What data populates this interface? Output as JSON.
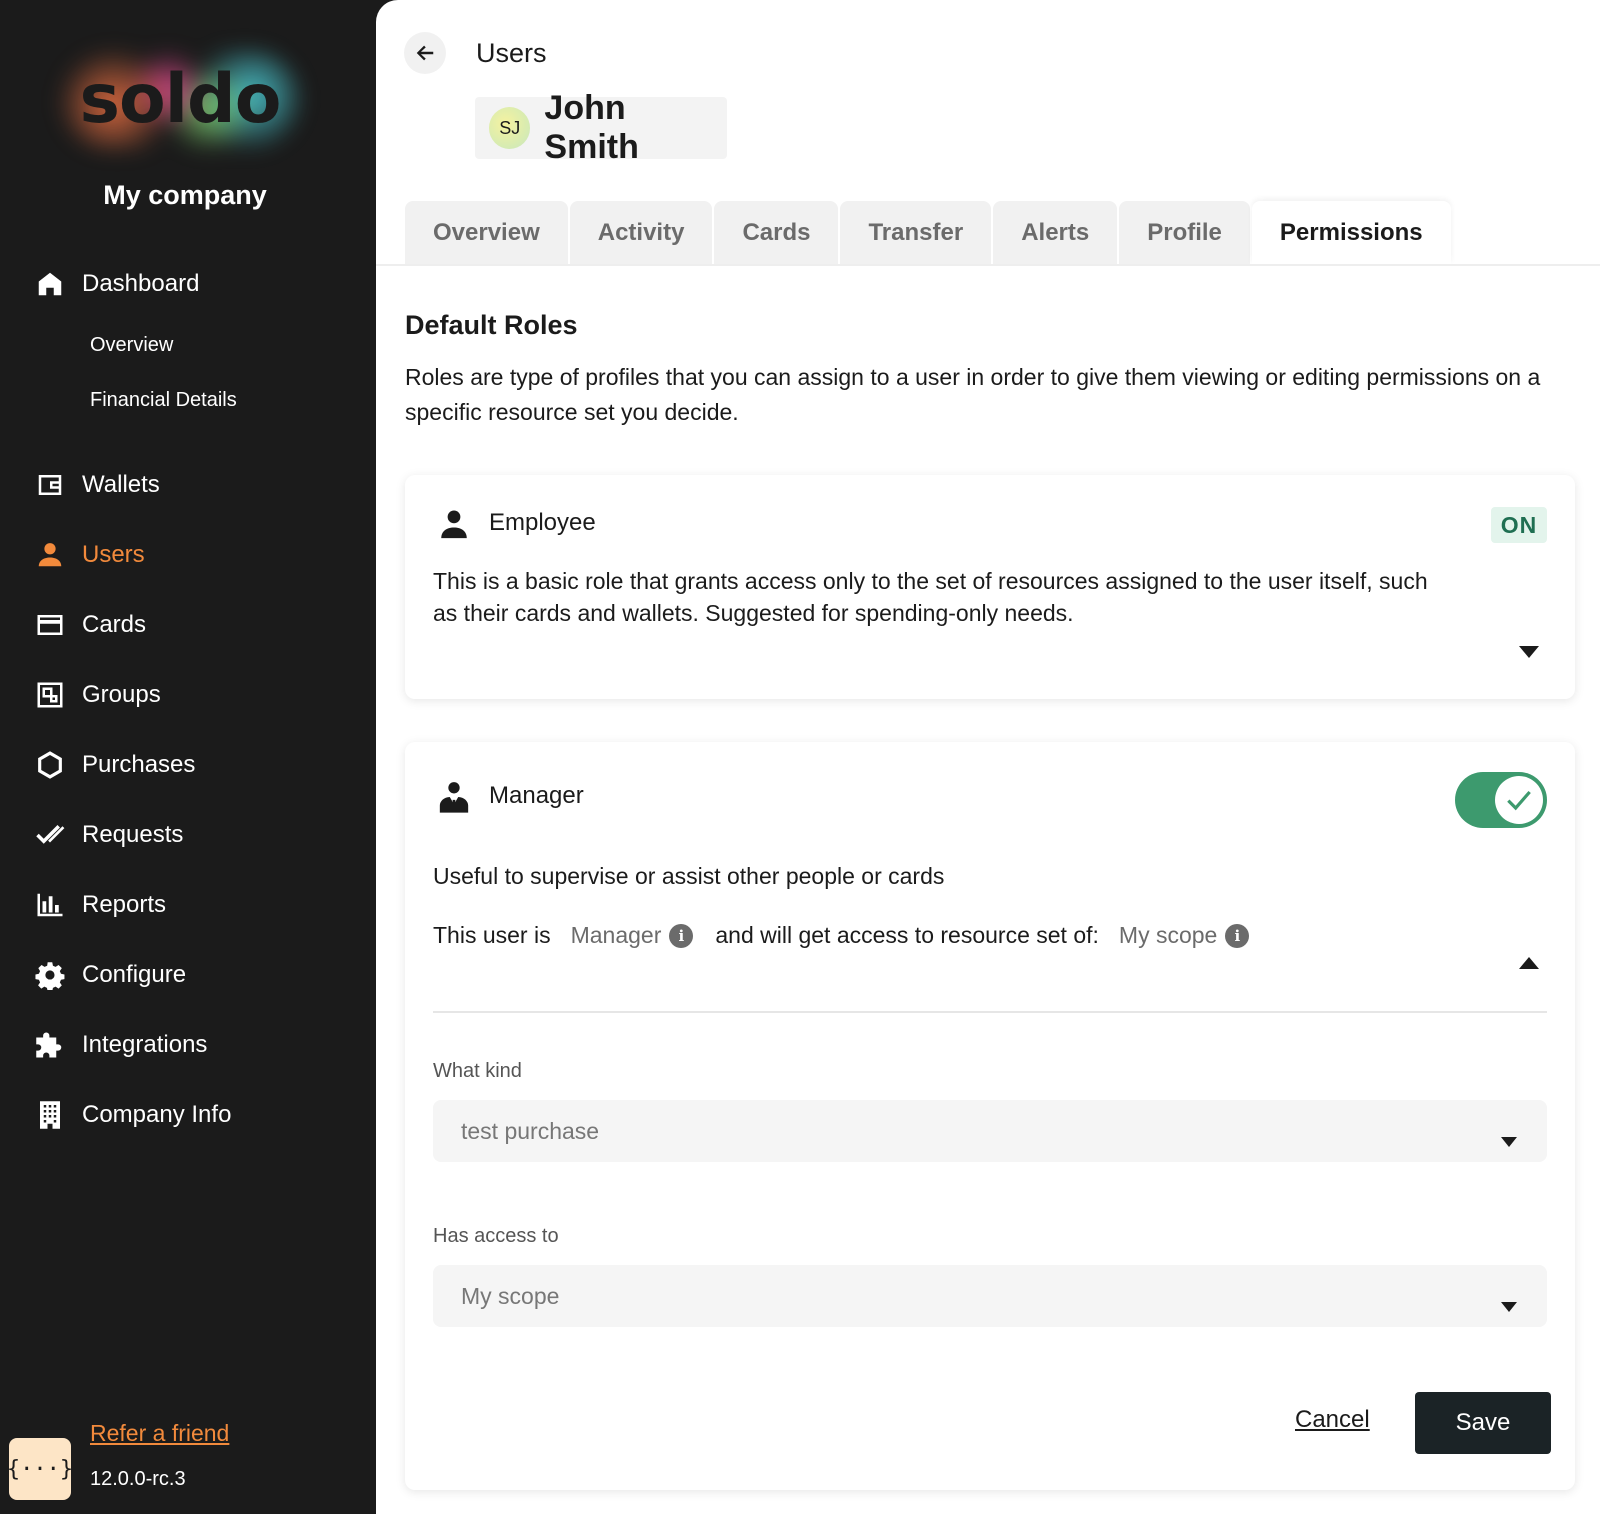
{
  "brand": {
    "logo_text": "soldo",
    "company": "My company"
  },
  "sidebar": {
    "items": [
      {
        "label": "Dashboard",
        "icon": "home-icon"
      },
      {
        "label": "Overview"
      },
      {
        "label": "Financial Details"
      },
      {
        "label": "Wallets",
        "icon": "wallet-icon"
      },
      {
        "label": "Users",
        "icon": "user-icon",
        "active": true
      },
      {
        "label": "Cards",
        "icon": "card-icon"
      },
      {
        "label": "Groups",
        "icon": "groups-icon"
      },
      {
        "label": "Purchases",
        "icon": "hexagon-icon"
      },
      {
        "label": "Requests",
        "icon": "double-check-icon"
      },
      {
        "label": "Reports",
        "icon": "bar-chart-icon"
      },
      {
        "label": "Configure",
        "icon": "gear-icon"
      },
      {
        "label": "Integrations",
        "icon": "puzzle-icon"
      },
      {
        "label": "Company Info",
        "icon": "building-icon"
      }
    ],
    "refer": "Refer a friend",
    "version": "12.0.0-rc.3",
    "dev_badge": "{···}"
  },
  "header": {
    "breadcrumb": "Users",
    "user_initials": "SJ",
    "user_name": "John Smith"
  },
  "tabs": [
    {
      "label": "Overview"
    },
    {
      "label": "Activity"
    },
    {
      "label": "Cards"
    },
    {
      "label": "Transfer"
    },
    {
      "label": "Alerts"
    },
    {
      "label": "Profile"
    },
    {
      "label": "Permissions",
      "active": true
    }
  ],
  "section": {
    "title": "Default Roles",
    "description": "Roles are type of profiles that you can assign to a user in order to give them viewing or editing permissions on a specific resource set you decide."
  },
  "employee": {
    "name": "Employee",
    "status": "ON",
    "description": "This is a basic role that grants access only to the set of resources assigned to the user itself, such as their cards and wallets. Suggested for spending-only needs."
  },
  "manager": {
    "name": "Manager",
    "enabled": true,
    "description": "Useful to supervise or assist other people or cards",
    "line_prefix": "This user is",
    "role_value": "Manager",
    "line_middle": "and will get access to resource set of:",
    "scope_value": "My scope",
    "info_glyph": "i",
    "what_kind_label": "What kind",
    "what_kind_value": "test purchase",
    "has_access_label": "Has access to",
    "has_access_value": "My scope",
    "cancel_label": "Cancel",
    "save_label": "Save"
  },
  "colors": {
    "accent": "#f28a3c",
    "toggle_on": "#3d9a6e",
    "sidebar_bg": "#1b1b1b",
    "save_bg": "#1b2326"
  }
}
